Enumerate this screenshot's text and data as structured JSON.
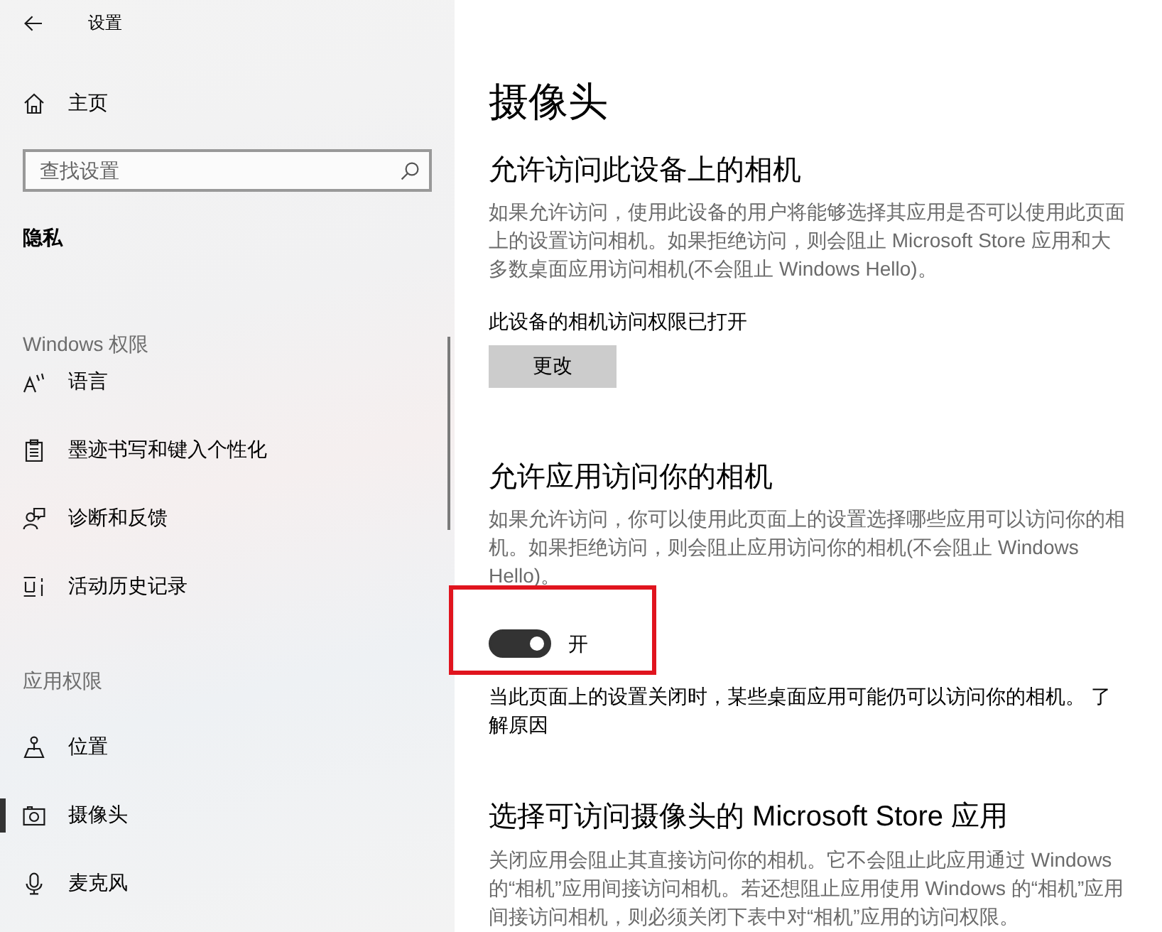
{
  "window": {
    "title": "设置"
  },
  "sidebar": {
    "home": "主页",
    "search": {
      "placeholder": "查找设置"
    },
    "category": "隐私",
    "groups": [
      {
        "heading": "Windows 权限",
        "items": [
          {
            "label": "语言",
            "selected": false
          },
          {
            "label": "墨迹书写和键入个性化",
            "selected": false
          },
          {
            "label": "诊断和反馈",
            "selected": false
          },
          {
            "label": "活动历史记录",
            "selected": false
          }
        ]
      },
      {
        "heading": "应用权限",
        "items": [
          {
            "label": "位置",
            "selected": false
          },
          {
            "label": "摄像头",
            "selected": true
          },
          {
            "label": "麦克风",
            "selected": false
          }
        ]
      }
    ]
  },
  "page": {
    "title": "摄像头",
    "sections": [
      {
        "heading": "允许访问此设备上的相机",
        "description": "如果允许访问，使用此设备的用户将能够选择其应用是否可以使用此页面上的设置访问相机。如果拒绝访问，则会阻止 Microsoft Store 应用和大多数桌面应用访问相机(不会阻止 Windows Hello)。",
        "status": "此设备的相机访问权限已打开",
        "button": "更改"
      },
      {
        "heading": "允许应用访问你的相机",
        "description": "如果允许访问，你可以使用此页面上的设置选择哪些应用可以访问你的相机。如果拒绝访问，则会阻止应用访问你的相机(不会阻止 Windows Hello)。",
        "toggle": {
          "on": true,
          "label": "开",
          "highlighted": true
        },
        "note": "当此页面上的设置关闭时，某些桌面应用可能仍可以访问你的相机。 了解原因"
      },
      {
        "heading": "选择可访问摄像头的 Microsoft Store 应用",
        "description": "关闭应用会阻止其直接访问你的相机。它不会阻止此应用通过 Windows 的“相机”应用间接访问相机。若还想阻止应用使用 Windows 的“相机”应用间接访问相机，则必须关闭下表中对“相机”应用的访问权限。"
      }
    ]
  }
}
